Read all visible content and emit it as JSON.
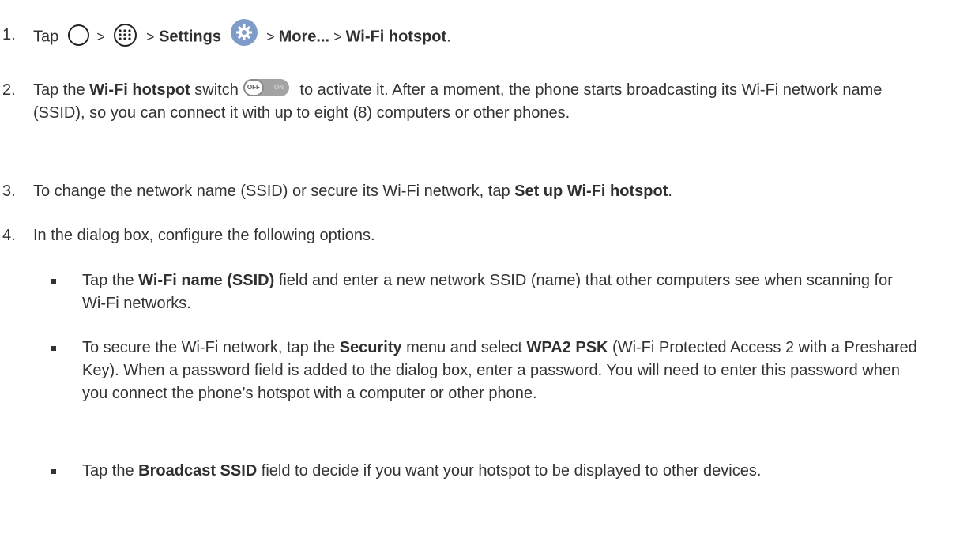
{
  "steps": [
    {
      "num": "1.",
      "tap": "Tap",
      "sep1": ">",
      "sep2": ">",
      "settings": "Settings",
      "sep3": "> ",
      "more": "More...",
      "sep4": " > ",
      "hotspot": "Wi-Fi hotspot",
      "end": "."
    },
    {
      "num": "2.",
      "pre": "Tap the ",
      "bold": "Wi-Fi hotspot",
      "mid": " switch",
      "post": " to activate it. After a moment, the phone starts broadcasting its Wi-Fi network name (SSID), so you can connect it with up to eight (8) computers or other phones."
    },
    {
      "num": "3.",
      "pre": "To change the network name (SSID) or secure its Wi-Fi network, tap ",
      "bold": "Set up Wi-Fi hotspot",
      "post": "."
    },
    {
      "num": "4.",
      "text": "In the dialog box, configure the following options."
    }
  ],
  "toggle": {
    "off": "OFF",
    "on": "ON"
  },
  "bullets": [
    {
      "pre": "Tap the ",
      "bold": "Wi-Fi name (SSID)",
      "post": " field and enter a new network SSID (name) that other computers see when scanning for Wi-Fi networks."
    },
    {
      "pre": "To secure the Wi-Fi network, tap the ",
      "bold1": "Security",
      "mid": " menu and select ",
      "bold2": "WPA2 PSK",
      "post": " (Wi-Fi Protected Access 2 with a Preshared Key). When a password field is added to the dialog box, enter a password. You will need to enter this password when you connect the phone’s hotspot with a computer or other phone."
    },
    {
      "pre": "Tap the ",
      "bold": "Broadcast SSID",
      "post": " field to decide if you want your hotspot to be displayed to other devices."
    }
  ],
  "icons": [
    "home-icon",
    "apps-icon",
    "settings-gear-icon",
    "toggle-switch-icon"
  ]
}
